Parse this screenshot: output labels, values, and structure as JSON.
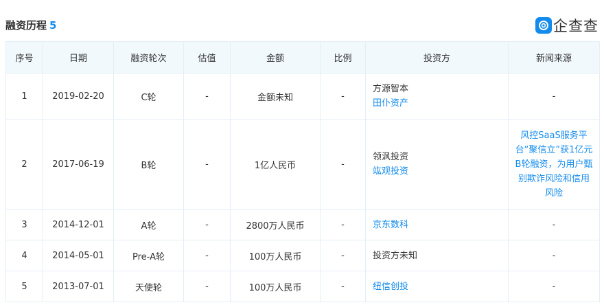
{
  "header": {
    "title": "融资历程",
    "count": "5",
    "logo_text": "企查查"
  },
  "table": {
    "columns": [
      "序号",
      "日期",
      "融资轮次",
      "估值",
      "金额",
      "比例",
      "投资方",
      "新闻来源"
    ],
    "rows": [
      {
        "no": "1",
        "date": "2019-02-20",
        "round": "C轮",
        "valuation": "-",
        "amount": "金额未知",
        "ratio": "-",
        "investors": [
          "方源智本",
          "田仆资产"
        ],
        "news": "-"
      },
      {
        "no": "2",
        "date": "2017-06-19",
        "round": "B轮",
        "valuation": "-",
        "amount": "1亿人民币",
        "ratio": "-",
        "investors": [
          "领沨投资",
          "竑观投资"
        ],
        "news": "风控SaaS服务平台“聚信立”获1亿元B轮融资，为用户甄别欺诈风险和信用风险"
      },
      {
        "no": "3",
        "date": "2014-12-01",
        "round": "A轮",
        "valuation": "-",
        "amount": "2800万人民币",
        "ratio": "-",
        "investors": [
          "京东数科"
        ],
        "news": "-"
      },
      {
        "no": "4",
        "date": "2014-05-01",
        "round": "Pre-A轮",
        "valuation": "-",
        "amount": "100万人民币",
        "ratio": "-",
        "investors": [
          "投资方未知"
        ],
        "news": "-"
      },
      {
        "no": "5",
        "date": "2013-07-01",
        "round": "天使轮",
        "valuation": "-",
        "amount": "100万人民币",
        "ratio": "-",
        "investors": [
          "纽信创投"
        ],
        "news": "-"
      }
    ]
  },
  "colors": {
    "accent": "#128bed",
    "header_bg": "#f2f9fc",
    "border": "#e4eef6"
  }
}
